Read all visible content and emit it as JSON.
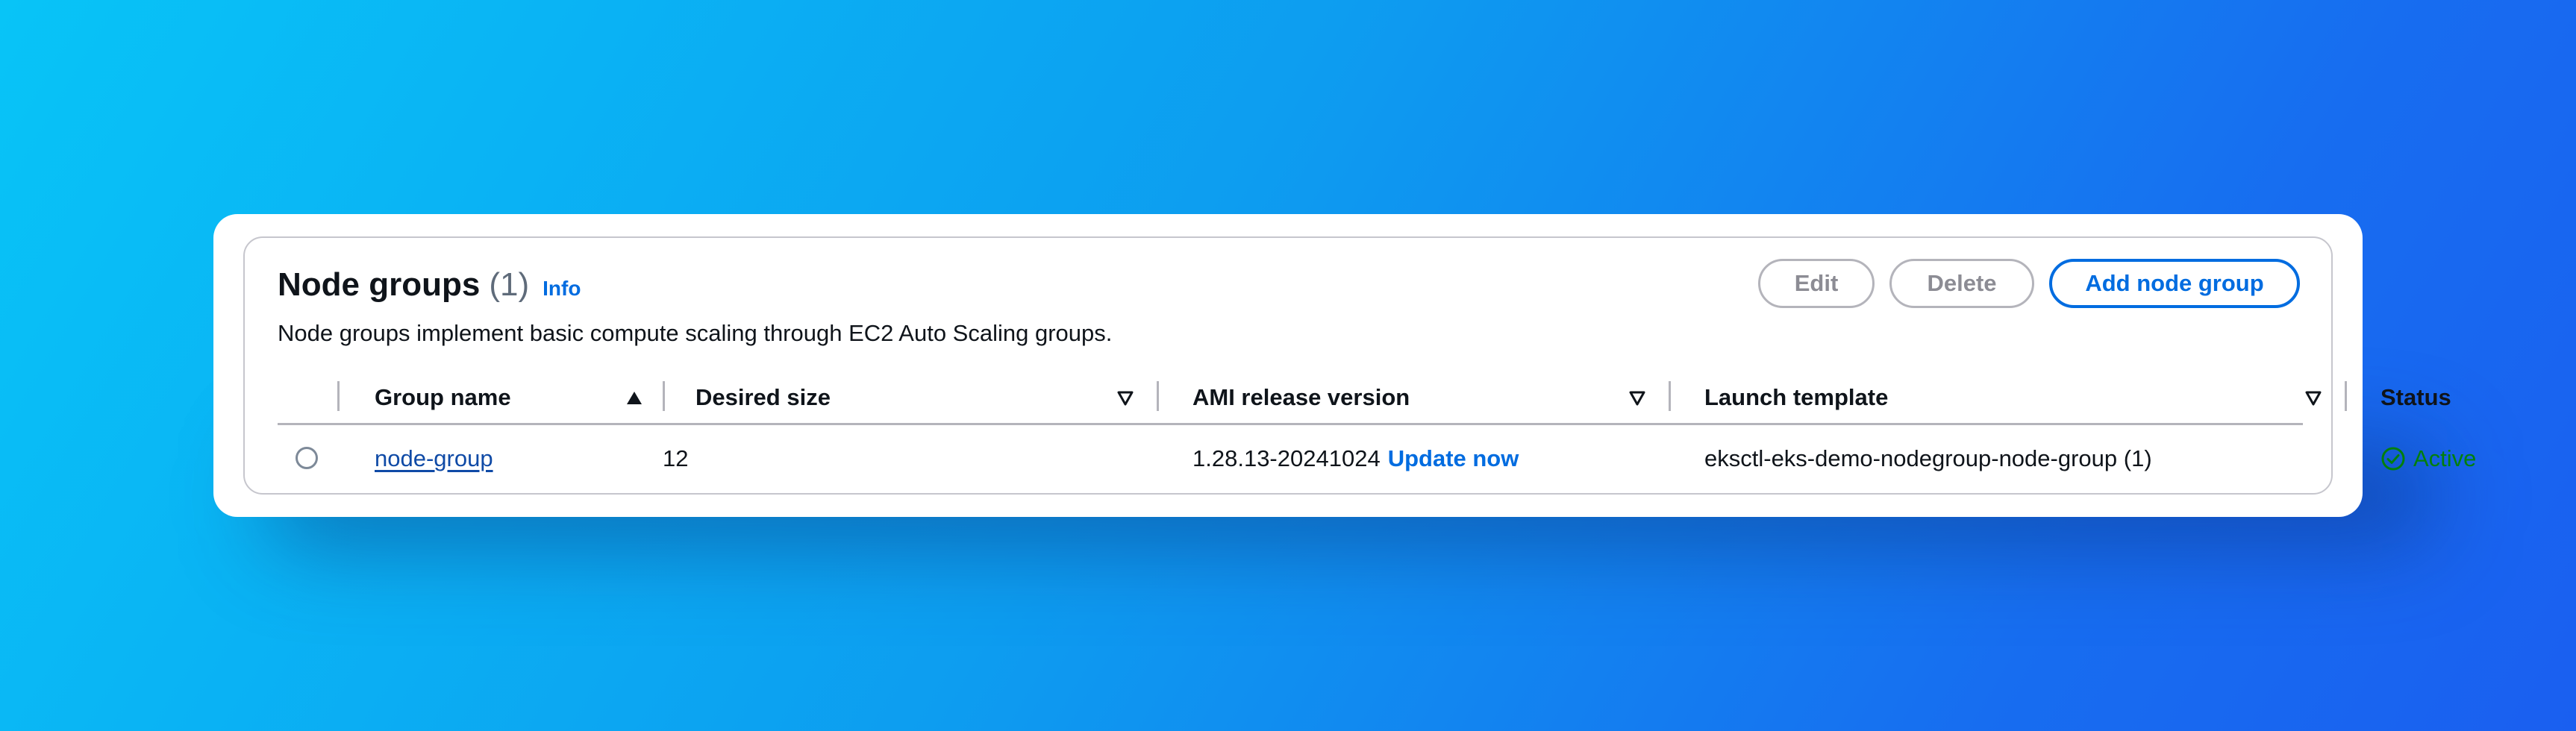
{
  "panel": {
    "title": "Node groups",
    "count": "(1)",
    "info_label": "Info",
    "description": "Node groups implement basic compute scaling through EC2 Auto Scaling groups."
  },
  "actions": {
    "edit_label": "Edit",
    "delete_label": "Delete",
    "add_label": "Add node group"
  },
  "table": {
    "columns": [
      "Group name",
      "Desired size",
      "AMI release version",
      "Launch template",
      "Status"
    ],
    "rows": [
      {
        "group_name": "node-group",
        "desired_size": "12",
        "ami_release_version": "1.28.13-20241024",
        "ami_update_label": "Update now",
        "launch_template": "eksctl-eks-demo-nodegroup-node-group (1)",
        "status": "Active"
      }
    ]
  },
  "colors": {
    "link": "#006ce0",
    "status_success": "#037f0c",
    "disabled": "#8c8c94"
  },
  "icons": {
    "sort_group_name": "caret-up-filled-icon",
    "sort_other": "caret-down-outline-icon",
    "status": "check-circle-icon"
  }
}
